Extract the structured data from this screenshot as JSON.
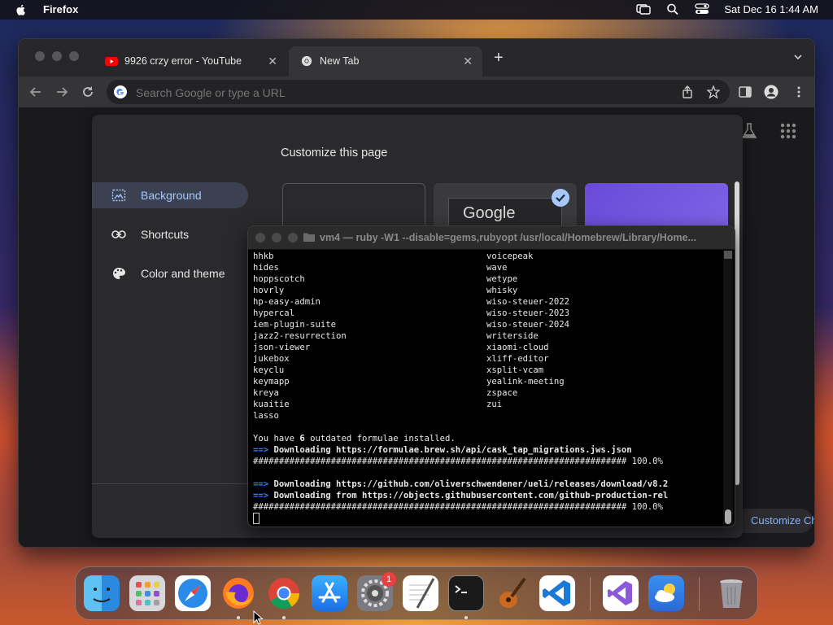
{
  "menubar": {
    "app_name": "Firefox",
    "clock": "Sat Dec 16  1:44 AM"
  },
  "browser": {
    "tabs": [
      {
        "label": "9926 crzy error - YouTube",
        "icon": "youtube-icon"
      },
      {
        "label": "New Tab",
        "icon": "chrome-icon"
      }
    ],
    "omnibox_placeholder": "Search Google or type a URL",
    "customize_button": "Customize Chrome"
  },
  "customize_dialog": {
    "title": "Customize this page",
    "nav": [
      {
        "label": "Background",
        "icon": "image-icon",
        "active": true
      },
      {
        "label": "Shortcuts",
        "icon": "link-icon"
      },
      {
        "label": "Color and theme",
        "icon": "palette-icon"
      }
    ],
    "thumb_text": "Google"
  },
  "terminal": {
    "title": "vm4 — ruby -W1 --disable=gems,rubyopt /usr/local/Homebrew/Library/Home...",
    "col1": [
      "hhkb",
      "hides",
      "hoppscotch",
      "hovrly",
      "hp-easy-admin",
      "hypercal",
      "iem-plugin-suite",
      "jazz2-resurrection",
      "json-viewer",
      "jukebox",
      "keyclu",
      "keymapp",
      "kreya",
      "kuaitie",
      "lasso"
    ],
    "col2": [
      "voicepeak",
      "wave",
      "wetype",
      "whisky",
      "wiso-steuer-2022",
      "wiso-steuer-2023",
      "wiso-steuer-2024",
      "writerside",
      "xiaomi-cloud",
      "xliff-editor",
      "xsplit-vcam",
      "yealink-meeting",
      "zspace",
      "zui"
    ],
    "outdated_pre": "You have ",
    "outdated_count": "6",
    "outdated_post": " outdated formulae installed.",
    "arrow": "==>",
    "dl1": " Downloading https://formulae.brew.sh/api/cask_tap_migrations.jws.json",
    "progress": "######################################################################## 100.0%",
    "dl2": " Downloading https://github.com/oliverschwendener/ueli/releases/download/v8.2",
    "dl3": " Downloading from https://objects.githubusercontent.com/github-production-rel"
  },
  "dock": {
    "apps": [
      "Finder",
      "Launchpad",
      "Safari",
      "Firefox",
      "Google Chrome",
      "App Store",
      "System Settings",
      "TextEdit",
      "Terminal",
      "GarageBand",
      "Visual Studio Code",
      "Visual Studio",
      "Weather",
      "Trash"
    ],
    "settings_badge": "1"
  }
}
